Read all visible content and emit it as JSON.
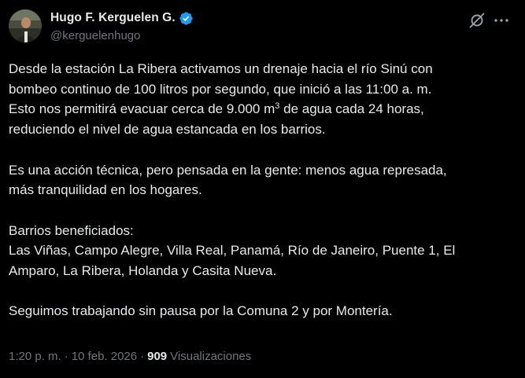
{
  "author": {
    "display_name": "Hugo F. Kerguelen G.",
    "handle": "@kerguelenhugo",
    "verified_color": "#1d9bf0"
  },
  "actions": {
    "grok_icon": "grok-icon",
    "more_icon": "more-horizontal-icon"
  },
  "tweet": {
    "p1_line1": "Desde la estación La Ribera activamos un drenaje hacia el río Sinú con",
    "p1_line2": "bombeo continuo de 100 litros por segundo, que inició a las 11:00 a. m.",
    "p1_line3a": "Esto nos permitirá evacuar cerca de 9.000 m",
    "p1_line3_sup": "3",
    "p1_line3b": " de agua cada 24 horas,",
    "p1_line4": "reduciendo el nivel de agua estancada en los barrios.",
    "p2_line1": "Es una acción técnica, pero pensada en la gente: menos agua represada,",
    "p2_line2": "más tranquilidad en los hogares.",
    "p3_line1": "Barrios beneficiados:",
    "p3_line2": "Las Viñas, Campo Alegre, Villa Real, Panamá, Río de Janeiro, Puente 1, El",
    "p3_line3": "Amparo, La Ribera, Holanda y Casita Nueva.",
    "p4_line1": "Seguimos trabajando sin pausa por la Comuna 2 y por Montería."
  },
  "meta": {
    "time": "1:20 p. m.",
    "separator": "·",
    "date": "10 feb. 2026",
    "views_count": "909",
    "views_label": "Visualizaciones"
  },
  "colors": {
    "background": "#000000",
    "text": "#e7e9ea",
    "secondary": "#71767b",
    "accent": "#1d9bf0"
  }
}
